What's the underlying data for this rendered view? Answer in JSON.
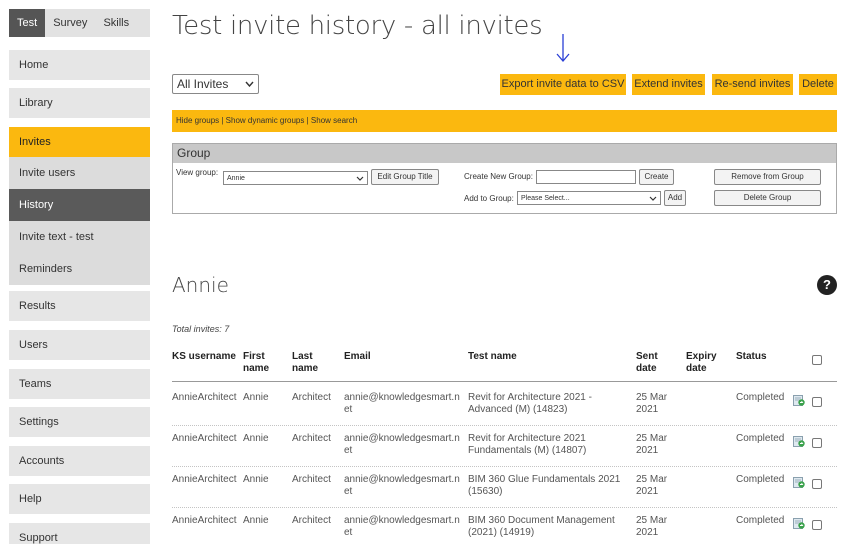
{
  "sidebar": {
    "top_tabs": [
      "Test",
      "Survey",
      "Skills"
    ],
    "items": {
      "home": "Home",
      "library": "Library",
      "invites": "Invites",
      "invite_users": "Invite users",
      "history": "History",
      "invite_text": "Invite text - test",
      "reminders": "Reminders",
      "results": "Results",
      "users": "Users",
      "teams": "Teams",
      "settings": "Settings",
      "accounts": "Accounts",
      "help": "Help",
      "support": "Support"
    }
  },
  "header": {
    "title": "Test invite history - all invites"
  },
  "toolbar": {
    "filter_value": "All Invites",
    "export": "Export invite data to CSV",
    "extend": "Extend invites",
    "resend": "Re-send invites",
    "delete": "Delete"
  },
  "links_bar": {
    "hide_groups": "Hide groups",
    "sep": " | ",
    "show_dynamic": "Show dynamic groups",
    "show_search": "Show search"
  },
  "group": {
    "header": "Group",
    "view_label": "View group:",
    "view_value": "Annie",
    "edit_title": "Edit Group Title",
    "create_label": "Create New Group:",
    "create_button": "Create",
    "add_label": "Add to Group:",
    "add_placeholder": "Please Select...",
    "add_button": "Add",
    "remove_button": "Remove from Group",
    "delete_button": "Delete Group"
  },
  "section": {
    "title": "Annie",
    "help": "?",
    "total": "Total invites: 7"
  },
  "table": {
    "headers": {
      "ks_username": "KS username",
      "first_name_1": "First",
      "first_name_2": "name",
      "last_name_1": "Last",
      "last_name_2": "name",
      "email": "Email",
      "test_name": "Test name",
      "sent_1": "Sent",
      "sent_2": "date",
      "expiry_1": "Expiry",
      "expiry_2": "date",
      "status": "Status"
    },
    "rows": [
      {
        "username": "AnnieArchitect",
        "first": "Annie",
        "last": "Architect",
        "email_1": "annie@knowledgesmart.n",
        "email_2": "et",
        "test_1": "Revit for Architecture 2021 -",
        "test_2": "Advanced (M) (14823)",
        "sent_1": "25 Mar",
        "sent_2": "2021",
        "status": "Completed"
      },
      {
        "username": "AnnieArchitect",
        "first": "Annie",
        "last": "Architect",
        "email_1": "annie@knowledgesmart.n",
        "email_2": "et",
        "test_1": "Revit for Architecture 2021",
        "test_2": "Fundamentals (M) (14807)",
        "sent_1": "25 Mar",
        "sent_2": "2021",
        "status": "Completed"
      },
      {
        "username": "AnnieArchitect",
        "first": "Annie",
        "last": "Architect",
        "email_1": "annie@knowledgesmart.n",
        "email_2": "et",
        "test_1": "BIM 360 Glue Fundamentals 2021",
        "test_2": "(15630)",
        "sent_1": "25 Mar",
        "sent_2": "2021",
        "status": "Completed"
      },
      {
        "username": "AnnieArchitect",
        "first": "Annie",
        "last": "Architect",
        "email_1": "annie@knowledgesmart.n",
        "email_2": "et",
        "test_1": "BIM 360 Document Management",
        "test_2": "(2021) (14919)",
        "sent_1": "25 Mar",
        "sent_2": "2021",
        "status": "Completed"
      }
    ]
  },
  "icons": {
    "arrow": "down-arrow-icon",
    "dropdown": "chevron-down-icon",
    "download": "download-icon",
    "help": "help-icon"
  },
  "colors": {
    "accent": "#fbb80f",
    "dark": "#5a5a5a",
    "arrow": "#2a3fd6"
  }
}
